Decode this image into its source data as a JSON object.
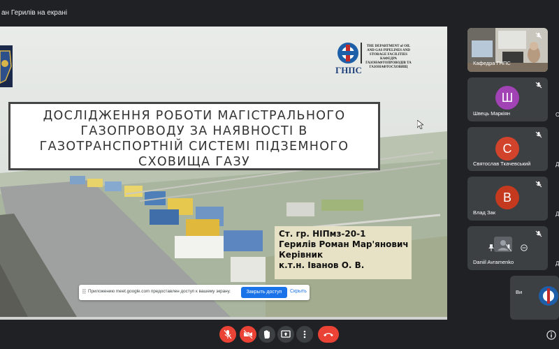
{
  "topbar": {
    "presenter_label": "ан Герилів на екрані"
  },
  "slide": {
    "logo_text": "ГНПС",
    "logo_org_text": "THE DEPARTMENT of OIL AND GAS PIPELINES AND STORAGE FACILITIES КАФЕДРА ГАЗОНАФТОПРОВОДІВ ТА ГАЗОНАФТОСХОВИЩ",
    "title_lines": [
      "ДОСЛІДЖЕННЯ РОБОТИ МАГІСТРАЛЬНОГО",
      "ГАЗОПРОВОДУ  ЗА НАЯВНОСТІ В",
      "ГАЗОТРАНСПОРТНІЙ СИСТЕМІ ПІДЗЕМНОГО",
      "СХОВИЩА ГАЗУ"
    ],
    "info_lines": [
      "Ст. гр. НІПмз-20-1",
      "Герилів Роман Мар'янович",
      "Керівник",
      "к.т.н. Іванов О. В."
    ]
  },
  "share_banner": {
    "handle": "⠿",
    "message": "Приложению meet.google.com предоставлен доступ к вашему экрану.",
    "stop_label": "Закрыть доступ",
    "hide_label": "Скрыть"
  },
  "participants": [
    {
      "name": "Кафедра ГНПС",
      "type": "video",
      "mic": "off"
    },
    {
      "name": "Швець Маркіян",
      "initial": "Ш",
      "color": "#a142b5",
      "mic": "off"
    },
    {
      "name": "Святослав Ткачевський",
      "initial": "С",
      "color": "#d1442b",
      "mic": "off"
    },
    {
      "name": "Влад Зак",
      "initial": "В",
      "color": "#c53a1f",
      "mic": "off"
    },
    {
      "name": "Daniil Avramenko",
      "type": "video",
      "mic": "off"
    },
    {
      "name": "Ви",
      "type": "logo",
      "mic": "off"
    }
  ],
  "edge_letters": [
    "C",
    "Д",
    "Д",
    "Д"
  ],
  "colors": {
    "background": "#202124",
    "tile": "#3c4043",
    "danger": "#ea4335",
    "accent": "#1a73e8"
  },
  "controls": [
    {
      "name": "mic-toggle",
      "state": "off"
    },
    {
      "name": "camera-toggle",
      "state": "off"
    },
    {
      "name": "raise-hand"
    },
    {
      "name": "present-screen"
    },
    {
      "name": "more-options"
    },
    {
      "name": "end-call"
    }
  ]
}
